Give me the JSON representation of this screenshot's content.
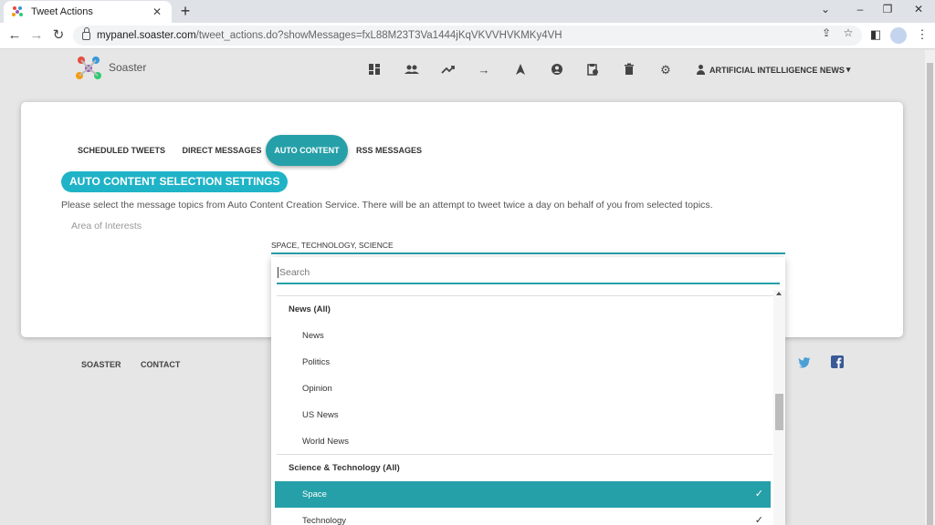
{
  "browser": {
    "tab_title": "Tweet Actions",
    "url_host": "mypanel.soaster.com",
    "url_path": "/tweet_actions.do?showMessages=fxL88M23T3Va1444jKqVKVVHVKMKy4VH"
  },
  "app": {
    "brand": "Soaster",
    "user_menu_label": "ARTIFICIAL INTELLIGENCE NEWS",
    "nav_icons": [
      "dashboard-icon",
      "users-icon",
      "trending-icon",
      "arrow-right-icon",
      "navigation-icon",
      "account-circle-icon",
      "clipboard-icon",
      "delete-icon",
      "settings-icon"
    ]
  },
  "tabs": [
    {
      "label": "SCHEDULED TWEETS",
      "active": false
    },
    {
      "label": "DIRECT MESSAGES",
      "active": false
    },
    {
      "label": "AUTO CONTENT",
      "active": true
    },
    {
      "label": "RSS MESSAGES",
      "active": false
    }
  ],
  "section": {
    "title": "AUTO CONTENT SELECTION SETTINGS",
    "description": "Please select the message topics from Auto Content Creation Service. There will be an attempt to tweet twice a day on behalf of you from selected topics.",
    "area_label": "Area of Interests",
    "selected_value": "SPACE, TECHNOLOGY, SCIENCE"
  },
  "dropdown": {
    "search_placeholder": "Search",
    "items": [
      {
        "label": "News (All)",
        "type": "group"
      },
      {
        "label": "News",
        "type": "option"
      },
      {
        "label": "Politics",
        "type": "option"
      },
      {
        "label": "Opinion",
        "type": "option"
      },
      {
        "label": "US News",
        "type": "option"
      },
      {
        "label": "World News",
        "type": "option"
      },
      {
        "label": "Science & Technology (All)",
        "type": "group"
      },
      {
        "label": "Space",
        "type": "option",
        "selected": true,
        "highlighted": true
      },
      {
        "label": "Technology",
        "type": "option",
        "selected": true
      }
    ]
  },
  "footer": {
    "links": [
      "SOASTER",
      "CONTACT"
    ],
    "social": [
      "twitter-icon",
      "facebook-icon"
    ]
  },
  "colors": {
    "accent": "#26a0a8",
    "title_badge": "#1fb3c7"
  }
}
